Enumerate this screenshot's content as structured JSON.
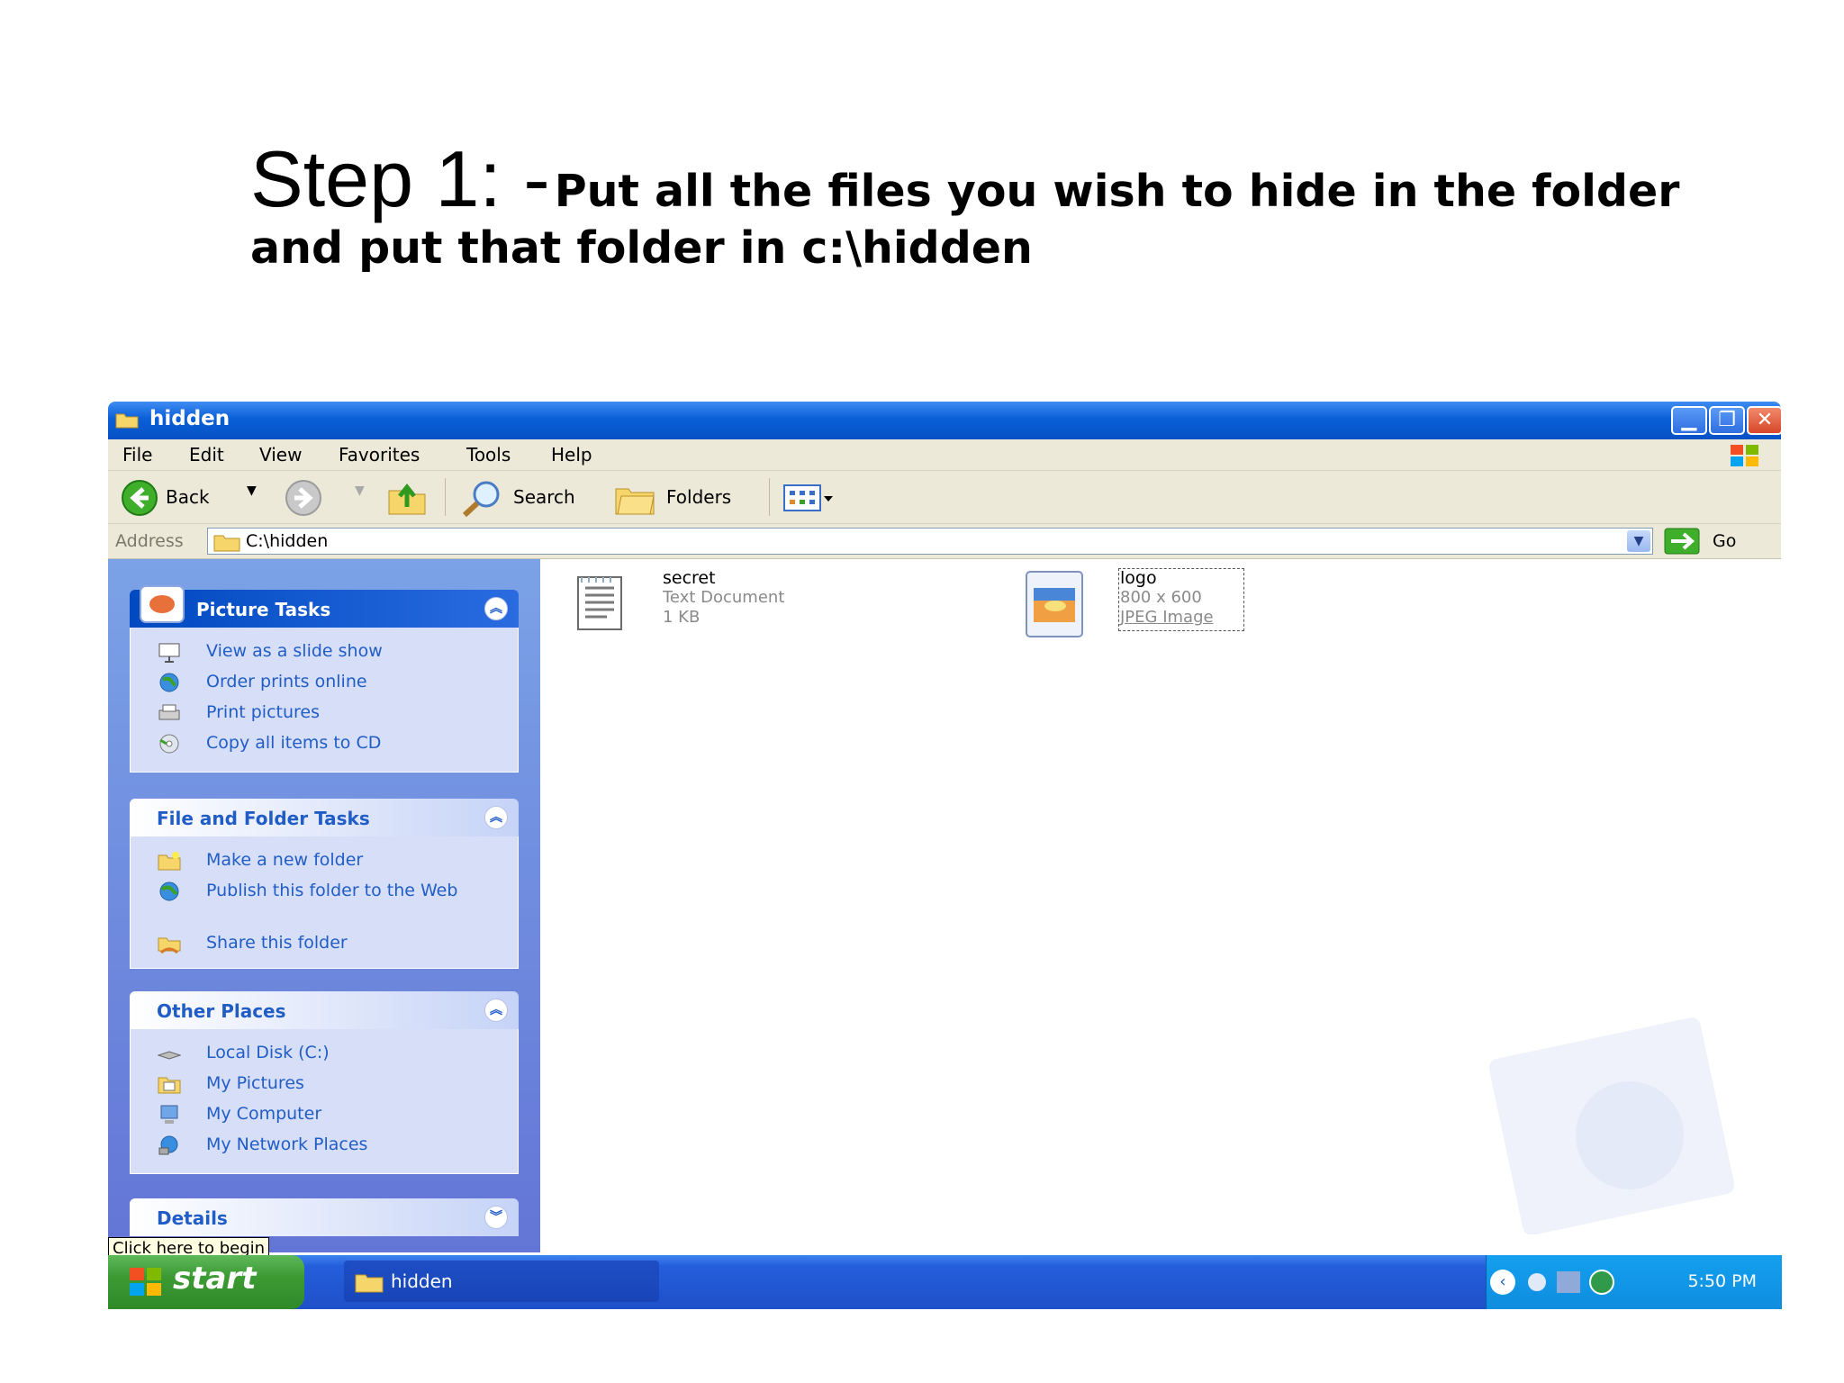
{
  "slide": {
    "step_label": "Step 1: -",
    "instruction_line1": "Put all the files you wish to hide in the folder",
    "instruction_line2": "and put that folder in c:\\hidden"
  },
  "window": {
    "title": "hidden",
    "menu": [
      "File",
      "Edit",
      "View",
      "Favorites",
      "Tools",
      "Help"
    ],
    "toolbar": {
      "back": "Back",
      "search": "Search",
      "folders": "Folders"
    },
    "address": {
      "label": "Address",
      "value": "C:\\hidden",
      "go": "Go"
    }
  },
  "panels": {
    "picture_tasks": {
      "title": "Picture Tasks",
      "items": [
        "View as a slide show",
        "Order prints online",
        "Print pictures",
        "Copy all items to CD"
      ]
    },
    "file_folder_tasks": {
      "title": "File and Folder Tasks",
      "items": [
        "Make a new folder",
        "Publish this folder to the Web",
        "Share this folder"
      ]
    },
    "other_places": {
      "title": "Other Places",
      "items": [
        "Local Disk (C:)",
        "My Pictures",
        "My Computer",
        "My Network Places"
      ]
    },
    "details": {
      "title": "Details"
    }
  },
  "files": [
    {
      "name": "secret",
      "type": "Text Document",
      "size": "1 KB",
      "icon": "text-document-icon"
    },
    {
      "name": "logo",
      "dimensions": "800 x 600",
      "type": "JPEG Image",
      "icon": "jpeg-image-icon"
    }
  ],
  "taskbar": {
    "start": "start",
    "tooltip": "Click here to begin",
    "task": "hidden",
    "clock": "5:50 PM"
  },
  "colors": {
    "title_blue": "#0a5fd8",
    "taskbar_blue": "#245edb",
    "start_green": "#3c9a33",
    "task_link": "#215dc6",
    "pane_bg": "#6f8ee0"
  }
}
